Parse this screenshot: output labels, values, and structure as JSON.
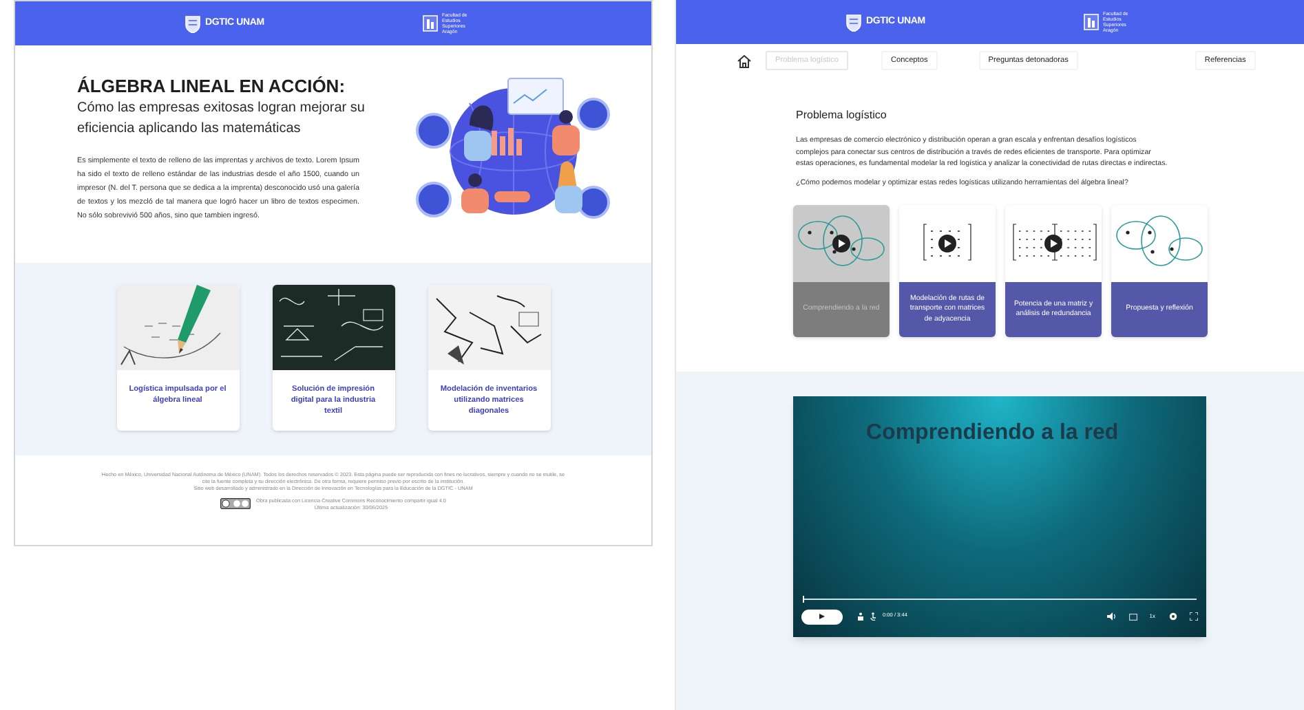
{
  "left_page": {
    "header": {
      "logo_text": "DGTIC UNAM",
      "faculty_text": "Facultad de Estudios Superiores Aragón"
    },
    "hero": {
      "title": "ÁLGEBRA LINEAL EN ACCIÓN:",
      "subtitle": "Cómo las empresas exitosas logran mejorar su eficiencia aplicando las matemáticas",
      "body": "Es simplemente el texto de relleno de las imprentas y archivos de texto. Lorem Ipsum ha sido el texto de relleno estándar de las industrias desde el año 1500, cuando un impresor (N. del T. persona que se dedica a la imprenta) desconocido usó una galería de textos y los mezcló de tal manera que logró hacer un libro de textos especimen. No sólo sobrevivió 500 años, sino que tambien ingresó."
    },
    "cards": [
      {
        "kind": "pencil",
        "label": "Logística impulsada por el álgebra lineal"
      },
      {
        "kind": "chalkboard",
        "label": "Solución de impresión digital para la industria textil"
      },
      {
        "kind": "sketch",
        "label": "Modelación de inventarios utilizando matrices diagonales"
      }
    ],
    "footer": {
      "lines": [
        "Hecho en México, Universidad Nacional Autónoma de México (UNAM). Todos los derechos reservados © 2023. Esta página puede ser reproducida con fines no lucrativos, siempre y cuando no se mutile, se cite la fuente completa y su dirección electrónica. De otra forma, requiere permiso previo por escrito de la institución.",
        "Sitio web desarrollado y administrado en la Dirección de Innovación en Tecnologías para la Educación de la DGTIC - UNAM"
      ],
      "license": "Obra publicada con Licencia Creative Commons Reconocimiento compartir igual 4.0",
      "updated": "Última actualización: 30/06/2025"
    }
  },
  "right_page": {
    "header": {
      "logo_text": "DGTIC UNAM",
      "faculty_text": "Facultad de Estudios Superiores Aragón"
    },
    "nav": [
      {
        "label": "Problema logístico",
        "selected": true
      },
      {
        "label": "Conceptos",
        "selected": false
      },
      {
        "label": "Preguntas detonadoras",
        "selected": false
      },
      {
        "label": "Referencias",
        "selected": false
      }
    ],
    "section": {
      "heading": "Problema logístico",
      "body": "Las empresas de comercio electrónico y distribución operan a gran escala y enfrentan desafíos logísticos complejos para conectar sus centros de distribución a través de redes eficientes de transporte. Para optimizar estas operaciones, es fundamental modelar la red logística y analizar la conectividad de rutas directas e indirectas.",
      "question": "¿Cómo podemos modelar y optimizar estas redes logísticas utilizando herramientas del álgebra lineal?"
    },
    "lessons": [
      {
        "kind": "graph",
        "title": "Comprendiendo a la red",
        "selected": true,
        "play": true
      },
      {
        "kind": "matrix",
        "title": "Modelación de rutas de transporte con matrices de adyacencia",
        "selected": false,
        "play": true
      },
      {
        "kind": "matrix_pair",
        "title": "Potencia de una matriz y análisis de redundancia",
        "selected": false,
        "play": true
      },
      {
        "kind": "graph",
        "title": "Propuesta y reflexión",
        "selected": false,
        "play": false
      }
    ],
    "video": {
      "slide_title": "Comprendiendo a la red",
      "time": "0:00 / 3:44",
      "speed": "1x",
      "level": 0
    }
  }
}
